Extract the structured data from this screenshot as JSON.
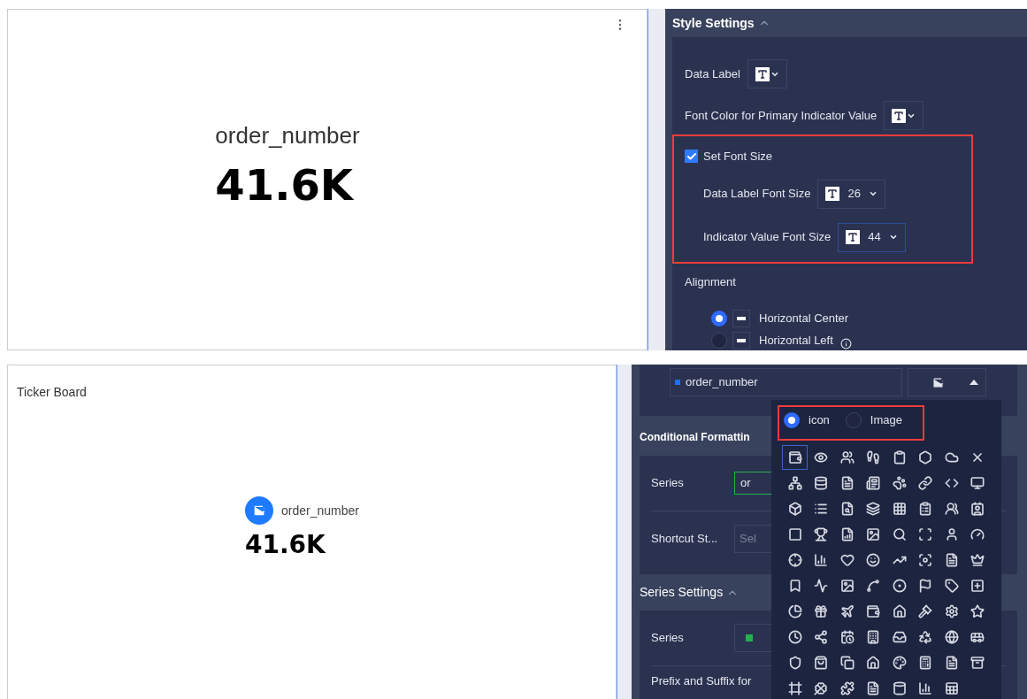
{
  "top": {
    "card": {
      "label": "order_number",
      "value": "41.6K"
    },
    "style_settings": {
      "title": "Style Settings",
      "expanded": true,
      "data_label": {
        "label": "Data Label"
      },
      "font_color": {
        "label": "Font Color for Primary Indicator Value"
      },
      "set_font_size": {
        "label": "Set Font Size",
        "checked": true
      },
      "font_sizes": [
        {
          "label": "Data Label Font Size",
          "value": "26",
          "focused": false
        },
        {
          "label": "Indicator Value Font Size",
          "value": "44",
          "focused": true
        }
      ],
      "alignment": {
        "label": "Alignment",
        "options": [
          {
            "label": "Horizontal Center",
            "selected": true,
            "info": false
          },
          {
            "label": "Horizontal Left",
            "selected": false,
            "info": true
          }
        ]
      }
    }
  },
  "bottom": {
    "card": {
      "title": "Ticker Board",
      "label": "order_number",
      "value": "41.6K"
    },
    "series_field": {
      "value": "order_number",
      "color": "#1e6fff"
    },
    "icon_button": {
      "expanded": true
    },
    "conditional_formatting": {
      "title": "Conditional Formattin",
      "rows": [
        {
          "label": "Series",
          "value": "or"
        },
        {
          "label": "Shortcut St...",
          "placeholder": "Sel"
        }
      ]
    },
    "series_settings": {
      "title": "Series Settings",
      "expanded": true,
      "rows": [
        {
          "label": "Series",
          "color": "#22b14c"
        },
        {
          "label": "Prefix and Suffix for"
        }
      ]
    },
    "icon_picker": {
      "modes": [
        {
          "label": "icon",
          "selected": true
        },
        {
          "label": "Image",
          "selected": false
        }
      ],
      "icons": [
        {
          "kind": "wallet",
          "selected": true
        },
        {
          "kind": "eye",
          "selected": false
        },
        {
          "kind": "users",
          "selected": false
        },
        {
          "kind": "footprints",
          "selected": false
        },
        {
          "kind": "clipboard",
          "selected": false
        },
        {
          "kind": "hexagon",
          "selected": false
        },
        {
          "kind": "cloud",
          "selected": false
        },
        {
          "kind": "cross",
          "selected": false
        },
        {
          "kind": "network",
          "selected": false
        },
        {
          "kind": "database",
          "selected": false
        },
        {
          "kind": "file",
          "selected": false
        },
        {
          "kind": "newspaper",
          "selected": false
        },
        {
          "kind": "paw",
          "selected": false
        },
        {
          "kind": "link",
          "selected": false
        },
        {
          "kind": "code",
          "selected": false
        },
        {
          "kind": "monitor",
          "selected": false
        },
        {
          "kind": "box",
          "selected": false
        },
        {
          "kind": "list",
          "selected": false
        },
        {
          "kind": "file-search",
          "selected": false
        },
        {
          "kind": "layers",
          "selected": false
        },
        {
          "kind": "grid",
          "selected": false
        },
        {
          "kind": "clipboard-list",
          "selected": false
        },
        {
          "kind": "users-round",
          "selected": false
        },
        {
          "kind": "contact",
          "selected": false
        },
        {
          "kind": "square",
          "selected": false
        },
        {
          "kind": "trophy",
          "selected": false
        },
        {
          "kind": "file-chart",
          "selected": false
        },
        {
          "kind": "image",
          "selected": false
        },
        {
          "kind": "search",
          "selected": false
        },
        {
          "kind": "scan",
          "selected": false
        },
        {
          "kind": "user",
          "selected": false
        },
        {
          "kind": "gauge",
          "selected": false
        },
        {
          "kind": "crosshair",
          "selected": false
        },
        {
          "kind": "bar-chart",
          "selected": false
        },
        {
          "kind": "heart",
          "selected": false
        },
        {
          "kind": "smile",
          "selected": false
        },
        {
          "kind": "trend",
          "selected": false
        },
        {
          "kind": "focus",
          "selected": false
        },
        {
          "kind": "file",
          "selected": false
        },
        {
          "kind": "crown",
          "selected": false
        },
        {
          "kind": "bookmark",
          "selected": false
        },
        {
          "kind": "activity",
          "selected": false
        },
        {
          "kind": "image",
          "selected": false
        },
        {
          "kind": "spline",
          "selected": false
        },
        {
          "kind": "circle-dot",
          "selected": false
        },
        {
          "kind": "flag",
          "selected": false
        },
        {
          "kind": "tag",
          "selected": false
        },
        {
          "kind": "square-plus",
          "selected": false
        },
        {
          "kind": "pie",
          "selected": false
        },
        {
          "kind": "gift",
          "selected": false
        },
        {
          "kind": "plane",
          "selected": false
        },
        {
          "kind": "wallet",
          "selected": false
        },
        {
          "kind": "house",
          "selected": false
        },
        {
          "kind": "gavel",
          "selected": false
        },
        {
          "kind": "settings",
          "selected": false
        },
        {
          "kind": "star",
          "selected": false
        },
        {
          "kind": "clock",
          "selected": false
        },
        {
          "kind": "share",
          "selected": false
        },
        {
          "kind": "calendar-clock",
          "selected": false
        },
        {
          "kind": "building",
          "selected": false
        },
        {
          "kind": "inbox",
          "selected": false
        },
        {
          "kind": "recycle",
          "selected": false
        },
        {
          "kind": "globe",
          "selected": false
        },
        {
          "kind": "bus",
          "selected": false
        },
        {
          "kind": "shield",
          "selected": false
        },
        {
          "kind": "bag",
          "selected": false
        },
        {
          "kind": "copy",
          "selected": false
        },
        {
          "kind": "house",
          "selected": false
        },
        {
          "kind": "palette",
          "selected": false
        },
        {
          "kind": "calculator",
          "selected": false
        },
        {
          "kind": "file",
          "selected": false
        },
        {
          "kind": "archive",
          "selected": false
        },
        {
          "kind": "frame",
          "selected": false
        },
        {
          "kind": "clover",
          "selected": false
        },
        {
          "kind": "puzzle",
          "selected": false
        },
        {
          "kind": "file",
          "selected": false
        },
        {
          "kind": "cylinder",
          "selected": false
        },
        {
          "kind": "bar-chart",
          "selected": false
        },
        {
          "kind": "sheet",
          "selected": false
        }
      ]
    }
  }
}
